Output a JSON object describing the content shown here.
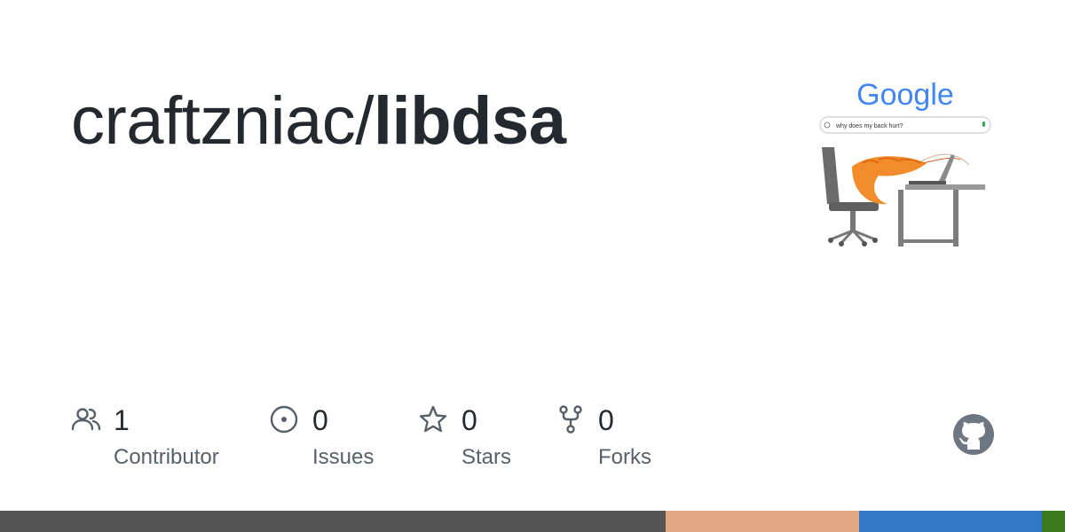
{
  "repo": {
    "owner": "craftzniac/",
    "name": "libdsa"
  },
  "avatar": {
    "logo_text": "Google",
    "search_query": "why does my back hurt?"
  },
  "stats": [
    {
      "icon": "people-icon",
      "value": "1",
      "label": "Contributor"
    },
    {
      "icon": "issue-icon",
      "value": "0",
      "label": "Issues"
    },
    {
      "icon": "star-icon",
      "value": "0",
      "label": "Stars"
    },
    {
      "icon": "fork-icon",
      "value": "0",
      "label": "Forks"
    }
  ],
  "github_logo": "github-mark-icon",
  "language_bar": [
    {
      "color": "#555555",
      "fraction": 0.625
    },
    {
      "color": "#e0a783",
      "fraction": 0.182
    },
    {
      "color": "#3178c6",
      "fraction": 0.171
    },
    {
      "color": "#3c7a1e",
      "fraction": 0.022
    }
  ]
}
